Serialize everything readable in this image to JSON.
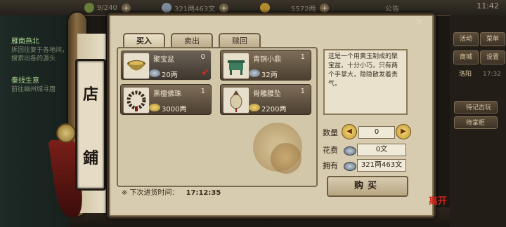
{
  "topbar": {
    "stamina": "9/240",
    "silver": "321两463文",
    "gold": "5572两",
    "notice": "公告",
    "time": "11:42"
  },
  "quests": [
    {
      "title": "雁南燕北",
      "body": "拆回往复于各地间，搜索出各的源头"
    },
    {
      "title": "秦线生意",
      "body": "前往幽州城寻唐"
    }
  ],
  "side_buttons": [
    "活动",
    "菜单",
    "商城",
    "设置",
    "洛阳",
    "17:32"
  ],
  "side_wide_buttons": [
    "待记古玩",
    "待掌柜"
  ],
  "shop": {
    "sign_chars": [
      "店",
      "鋪"
    ],
    "tabs": [
      "买入",
      "卖出",
      "赎回"
    ],
    "active_tab": 0,
    "items": [
      {
        "name": "聚宝盆",
        "qty": "0",
        "price": "20两",
        "selected": true,
        "icon": "treasure-bowl-icon"
      },
      {
        "name": "青铜小鼎",
        "qty": "1",
        "price": "32两",
        "selected": false,
        "icon": "bronze-cauldron-icon"
      },
      {
        "name": "黑檀佛珠",
        "qty": "1",
        "price": "3000两",
        "selected": false,
        "icon": "prayer-beads-icon"
      },
      {
        "name": "骨雕腰坠",
        "qty": "1",
        "price": "2200两",
        "selected": false,
        "icon": "bone-pendant-icon"
      }
    ],
    "restock_label": "※ 下次进货时间：",
    "restock_time": "17:12:35",
    "description": "这是一个用黄玉制成的聚宝盆，十分小巧，只有两个手掌大，隐隐散发着贵气。",
    "quantity_label": "数量",
    "quantity_value": "0",
    "cost_label": "花费",
    "cost_value": "0文",
    "own_label": "拥有",
    "own_value": "321两463文",
    "buy_label": "购买",
    "leave_label": "离开"
  },
  "colors": {
    "panel": "#d8ccb0",
    "item_bg": "#5f5141",
    "accent_red": "#c92519"
  }
}
